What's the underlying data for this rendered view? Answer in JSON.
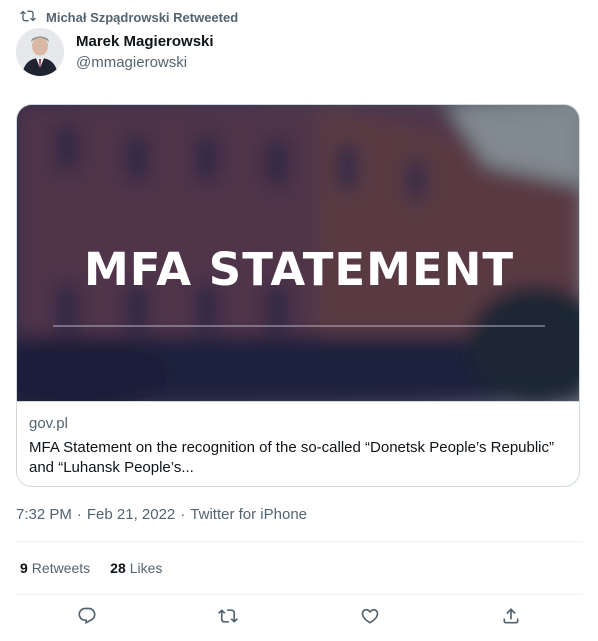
{
  "retweeted_by": "Michał Szpądrowski Retweeted",
  "author": {
    "name": "Marek Magierowski",
    "handle": "@mmagierowski"
  },
  "card": {
    "image_text": "MFA STATEMENT",
    "domain": "gov.pl",
    "description": "MFA Statement on the recognition of the so-called “Donetsk People’s Republic” and “Luhansk People’s..."
  },
  "tweet_meta": {
    "time": "7:32 PM",
    "date": "Feb 21, 2022",
    "source": "Twitter for iPhone",
    "separator": "·"
  },
  "stats": {
    "retweets_count": "9",
    "retweets_label": "Retweets",
    "likes_count": "28",
    "likes_label": "Likes"
  },
  "icons": {
    "retweet": "retweet-icon",
    "reply": "reply-icon",
    "like": "like-icon",
    "share": "share-icon"
  },
  "colors": {
    "muted": "#536471",
    "border": "#cfd9de",
    "text": "#0f1419"
  }
}
